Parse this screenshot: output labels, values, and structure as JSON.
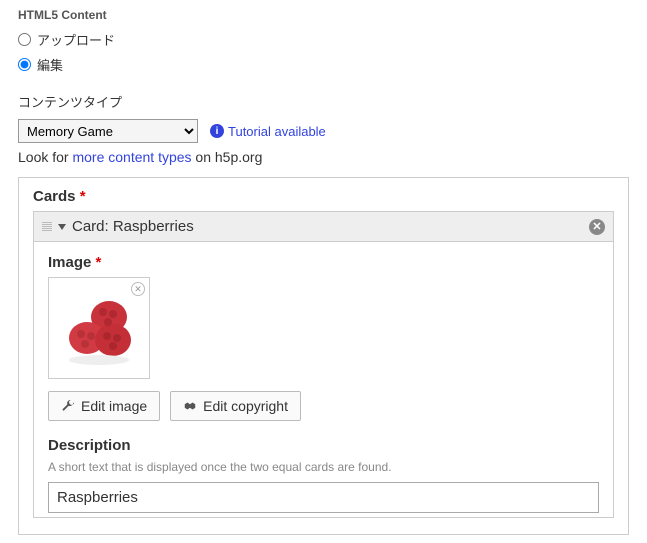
{
  "header": {
    "title": "HTML5 Content"
  },
  "mode": {
    "upload_label": "アップロード",
    "edit_label": "編集"
  },
  "content_type": {
    "label": "コンテンツタイプ",
    "selected": "Memory Game",
    "tutorial_text": "Tutorial available",
    "lookfor_prefix": "Look for ",
    "lookfor_link": "more content types",
    "lookfor_suffix": " on h5p.org"
  },
  "cards": {
    "section_label": "Cards",
    "card_header": "Card: Raspberries",
    "image_label": "Image",
    "edit_image_label": "Edit image",
    "edit_copyright_label": "Edit copyright",
    "description_label": "Description",
    "description_help": "A short text that is displayed once the two equal cards are found.",
    "description_value": "Raspberries"
  }
}
